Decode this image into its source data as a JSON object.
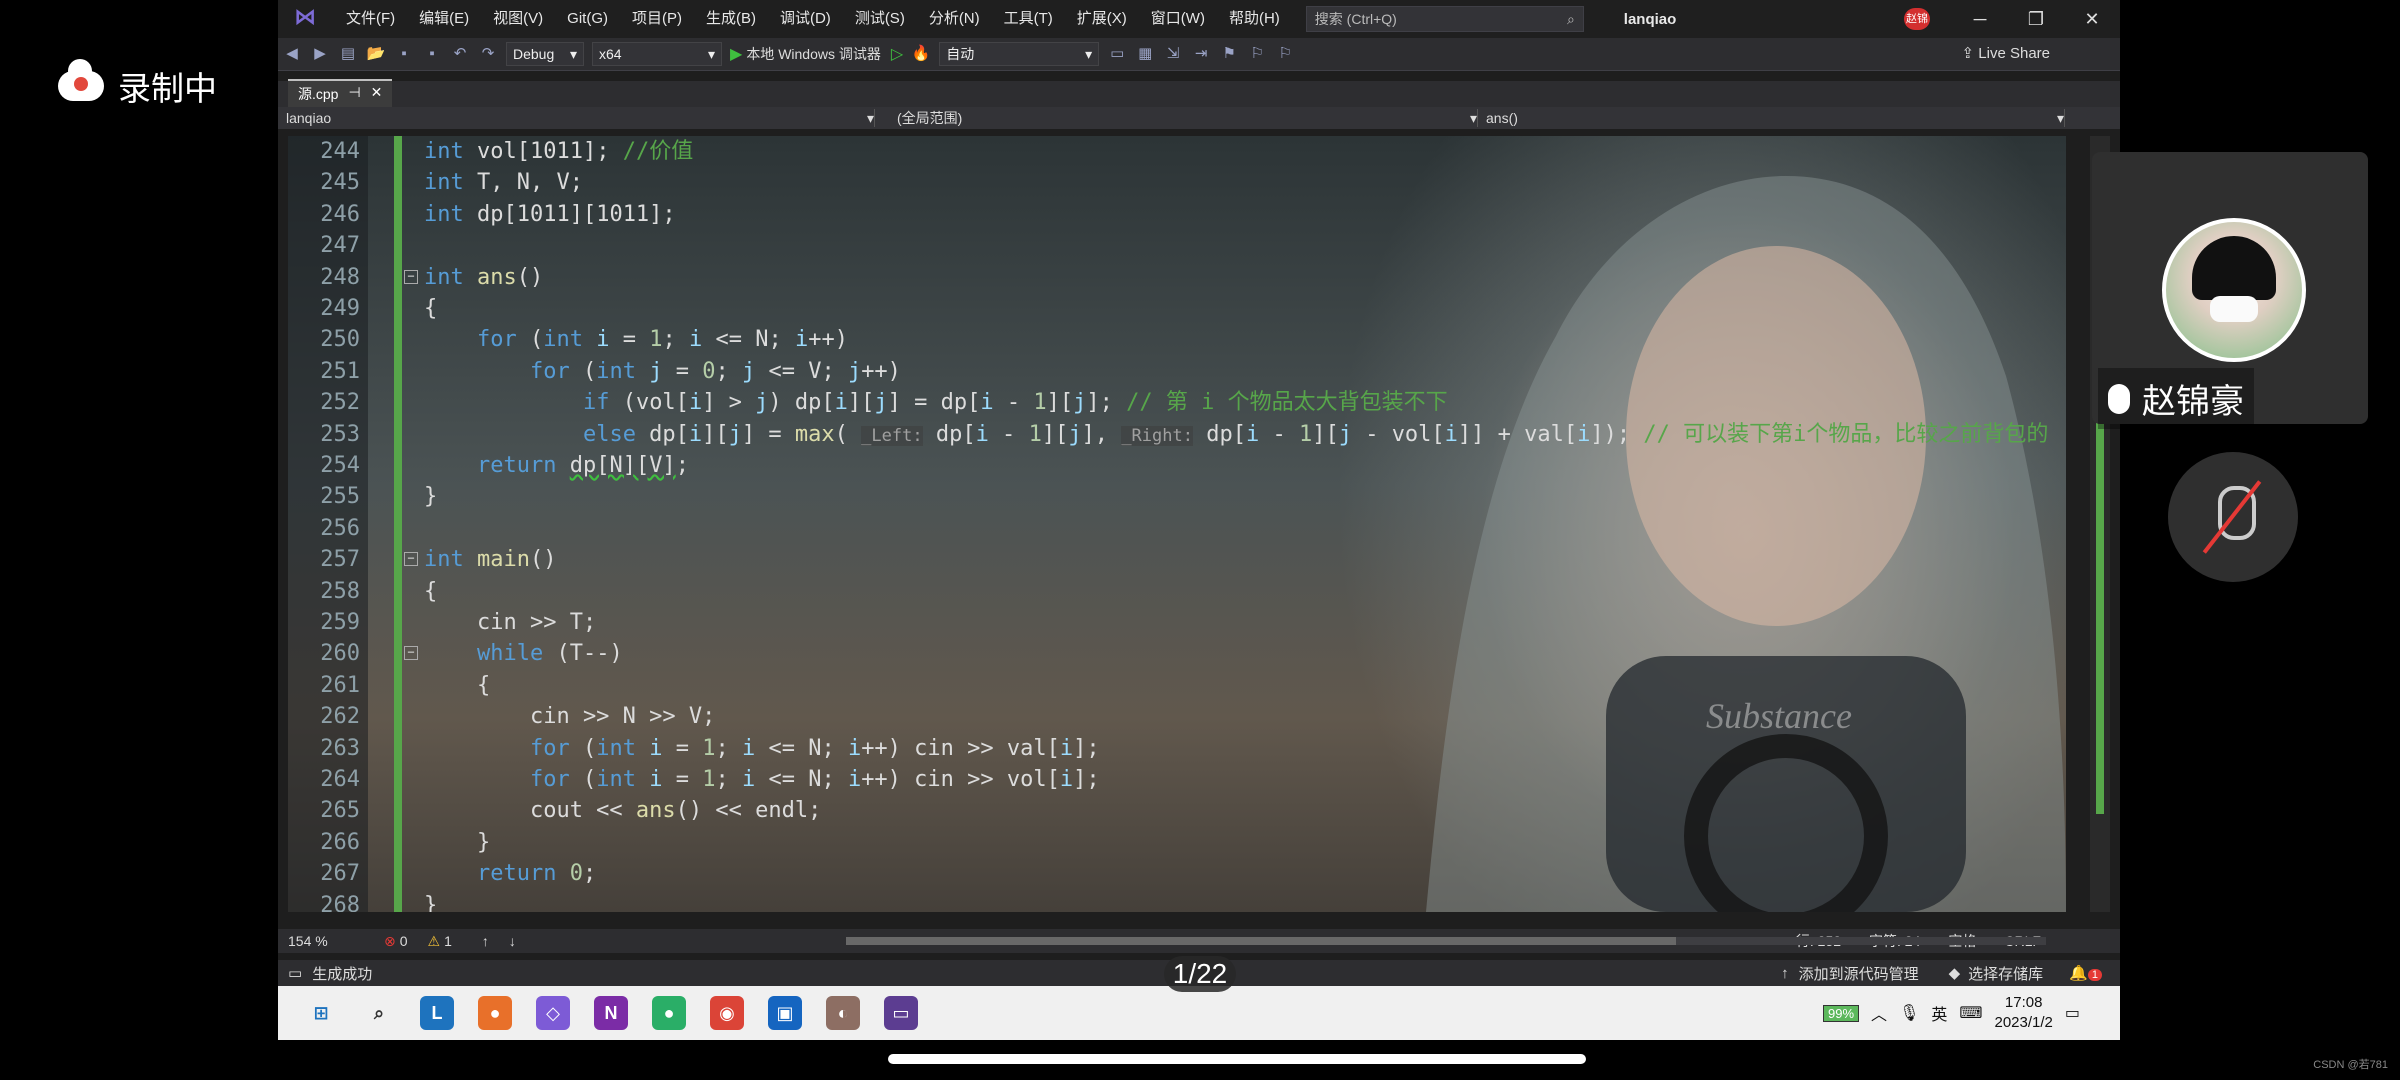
{
  "recording": {
    "label": "录制中"
  },
  "window": {
    "menu": [
      "文件(F)",
      "编辑(E)",
      "视图(V)",
      "Git(G)",
      "项目(P)",
      "生成(B)",
      "调试(D)",
      "测试(S)",
      "分析(N)",
      "工具(T)",
      "扩展(X)",
      "窗口(W)",
      "帮助(H)"
    ],
    "search_placeholder": "搜索 (Ctrl+Q)",
    "project": "lanqiao",
    "user_badge": "赵锦"
  },
  "toolbar": {
    "config": "Debug",
    "platform": "x64",
    "debugger": "本地 Windows 调试器",
    "auto": "自动",
    "live_share": "Live Share"
  },
  "tab": {
    "name": "源.cpp",
    "pin": "⊣",
    "close": "✕"
  },
  "navbar": {
    "project": "lanqiao",
    "scope": "(全局范围)",
    "member": "ans()"
  },
  "code": [
    {
      "n": "244",
      "html": "<span class='kw'>int</span> vol[1011]; <span class='cm'>//价值</span>"
    },
    {
      "n": "245",
      "html": "<span class='kw'>int</span> T, N, V;"
    },
    {
      "n": "246",
      "html": "<span class='kw'>int</span> dp[1011][1011];"
    },
    {
      "n": "247",
      "html": ""
    },
    {
      "n": "248",
      "html": "<span class='kw'>int</span> <span class='fn'>ans</span>()",
      "fold": true
    },
    {
      "n": "249",
      "html": "{"
    },
    {
      "n": "250",
      "html": "    <span class='kw'>for</span> (<span class='kw'>int</span> <span class='var'>i</span> = <span class='num'>1</span>; <span class='var'>i</span> &lt;= N; <span class='var'>i</span>++)"
    },
    {
      "n": "251",
      "html": "        <span class='kw'>for</span> (<span class='kw'>int</span> <span class='var'>j</span> = <span class='num'>0</span>; <span class='var'>j</span> &lt;= V; <span class='var'>j</span>++)"
    },
    {
      "n": "252",
      "html": "            <span class='kw'>if</span> (vol[<span class='var'>i</span>] &gt; <span class='var'>j</span>) dp[<span class='var'>i</span>][<span class='var'>j</span>] = dp[<span class='var'>i</span> - <span class='num'>1</span>][<span class='var'>j</span>]; <span class='cm'>// 第 i 个物品太大背包装不下</span>"
    },
    {
      "n": "253",
      "html": "            <span class='kw'>else</span> dp[<span class='var'>i</span>][<span class='var'>j</span>] = <span class='fn'>max</span>( <span class='hint'>_Left:</span> dp[<span class='var'>i</span> - <span class='num'>1</span>][<span class='var'>j</span>], <span class='hint'>_Right:</span> dp[<span class='var'>i</span> - <span class='num'>1</span>][<span class='var'>j</span> - vol[<span class='var'>i</span>]] + val[<span class='var'>i</span>]); <span class='cm'>// 可以装下第i个物品，比较之前背包的</span>"
    },
    {
      "n": "254",
      "html": "    <span class='kw'>return</span> <span class='squig'>dp[N][V]</span>;"
    },
    {
      "n": "255",
      "html": "}"
    },
    {
      "n": "256",
      "html": ""
    },
    {
      "n": "257",
      "html": "<span class='kw'>int</span> <span class='fn'>main</span>()",
      "fold": true
    },
    {
      "n": "258",
      "html": "{"
    },
    {
      "n": "259",
      "html": "    cin &gt;&gt; T;"
    },
    {
      "n": "260",
      "html": "    <span class='kw'>while</span> (T--)",
      "fold": true
    },
    {
      "n": "261",
      "html": "    {"
    },
    {
      "n": "262",
      "html": "        cin &gt;&gt; N &gt;&gt; V;"
    },
    {
      "n": "263",
      "html": "        <span class='kw'>for</span> (<span class='kw'>int</span> <span class='var'>i</span> = <span class='num'>1</span>; <span class='var'>i</span> &lt;= N; <span class='var'>i</span>++) cin &gt;&gt; val[<span class='var'>i</span>];"
    },
    {
      "n": "264",
      "html": "        <span class='kw'>for</span> (<span class='kw'>int</span> <span class='var'>i</span> = <span class='num'>1</span>; <span class='var'>i</span> &lt;= N; <span class='var'>i</span>++) cin &gt;&gt; vol[<span class='var'>i</span>];"
    },
    {
      "n": "265",
      "html": "        cout &lt;&lt; <span class='fn'>ans</span>() &lt;&lt; endl;"
    },
    {
      "n": "266",
      "html": "    }"
    },
    {
      "n": "267",
      "html": "    <span class='kw'>return</span> <span class='num'>0</span>;"
    },
    {
      "n": "268",
      "html": "}"
    }
  ],
  "status": {
    "zoom": "154 %",
    "errors": "0",
    "warnings": "1",
    "line": "行: 252",
    "char": "字符: 24",
    "spaces": "空格",
    "eol": "CRLF"
  },
  "bottom": {
    "build": "生成成功",
    "add_source": "添加到源代码管理",
    "select_repo": "选择存储库",
    "notif": "1"
  },
  "tray": {
    "battery": "99%",
    "ime": "英",
    "time": "17:08",
    "date": "2023/1/2"
  },
  "page_indicator": "1/22",
  "participant": {
    "name": "赵锦豪"
  },
  "watermark": "CSDN @若781",
  "taskbar_icons": [
    {
      "name": "windows-start-icon",
      "glyph": "⊞",
      "color": "#1e73be"
    },
    {
      "name": "search-icon",
      "glyph": "⌕",
      "color": "#333"
    },
    {
      "name": "app-l-icon",
      "glyph": "L",
      "color": "#1e73be"
    },
    {
      "name": "firefox-icon",
      "glyph": "●",
      "color": "#e8702a"
    },
    {
      "name": "visual-studio-icon",
      "glyph": "◇",
      "color": "#7d5bd6"
    },
    {
      "name": "onenote-icon",
      "glyph": "N",
      "color": "#7b2ca6"
    },
    {
      "name": "wechat-icon",
      "glyph": "●",
      "color": "#2aae67"
    },
    {
      "name": "chrome-icon",
      "glyph": "◉",
      "color": "#db4437"
    },
    {
      "name": "photos-icon",
      "glyph": "▣",
      "color": "#1565c0"
    },
    {
      "name": "video-app-icon",
      "glyph": "◐",
      "color": "#8d6e63"
    },
    {
      "name": "terminal-icon",
      "glyph": "▭",
      "color": "#5c3d91"
    }
  ]
}
